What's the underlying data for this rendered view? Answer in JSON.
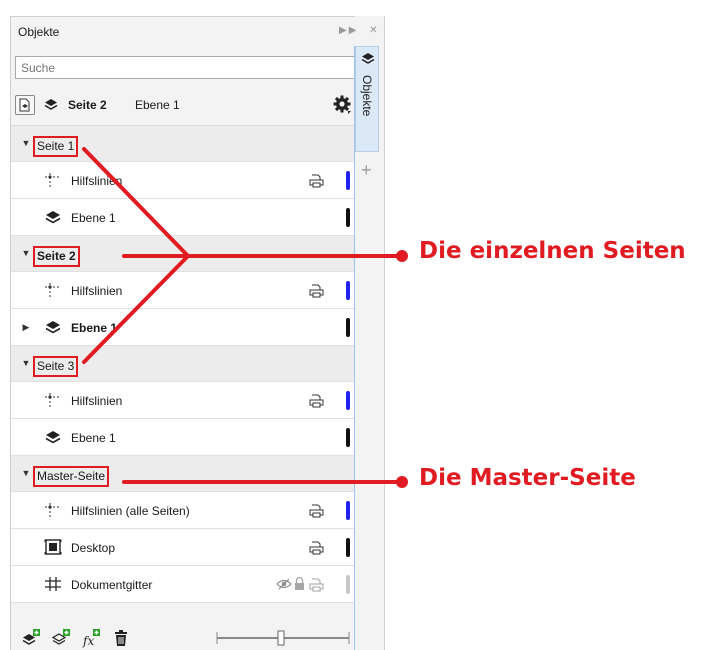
{
  "panel": {
    "title": "Objekte",
    "search_placeholder": "Suche",
    "current_page": "Seite 2",
    "current_layer": "Ebene 1",
    "side_tab_label": "Objekte"
  },
  "tree": [
    {
      "type": "page",
      "label": "Seite 1",
      "bold": false
    },
    {
      "type": "item",
      "icon": "guides-icon",
      "label": "Hilfslinien",
      "print": true,
      "color": "#2222ee"
    },
    {
      "type": "item",
      "icon": "layer-icon",
      "label": "Ebene 1",
      "print": false,
      "color": "#111111"
    },
    {
      "type": "page",
      "label": "Seite 2",
      "bold": true
    },
    {
      "type": "item",
      "icon": "guides-icon",
      "label": "Hilfslinien",
      "print": true,
      "color": "#2222ee"
    },
    {
      "type": "item",
      "icon": "layer-icon",
      "label": "Ebene 1",
      "print": false,
      "color": "#111111",
      "expandable": true,
      "bold": true
    },
    {
      "type": "page",
      "label": "Seite 3",
      "bold": false
    },
    {
      "type": "item",
      "icon": "guides-icon",
      "label": "Hilfslinien",
      "print": true,
      "color": "#2222ee"
    },
    {
      "type": "item",
      "icon": "layer-icon",
      "label": "Ebene 1",
      "print": false,
      "color": "#111111"
    },
    {
      "type": "page",
      "label": "Master-Seite",
      "bold": false
    },
    {
      "type": "item",
      "icon": "guides-icon",
      "label": "Hilfslinien (alle Seiten)",
      "print": true,
      "color": "#2222ee"
    },
    {
      "type": "item",
      "icon": "desktop-icon",
      "label": "Desktop",
      "print": true,
      "color": "#111111"
    },
    {
      "type": "item",
      "icon": "grid-icon",
      "label": "Dokumentgitter",
      "print": true,
      "dim": true,
      "eye": true,
      "lock": true,
      "color": "#c8c8c8"
    }
  ],
  "annotations": {
    "pages_callout": "Die einzelnen Seiten",
    "master_callout": "Die Master-Seite",
    "color": "#e11b22"
  }
}
